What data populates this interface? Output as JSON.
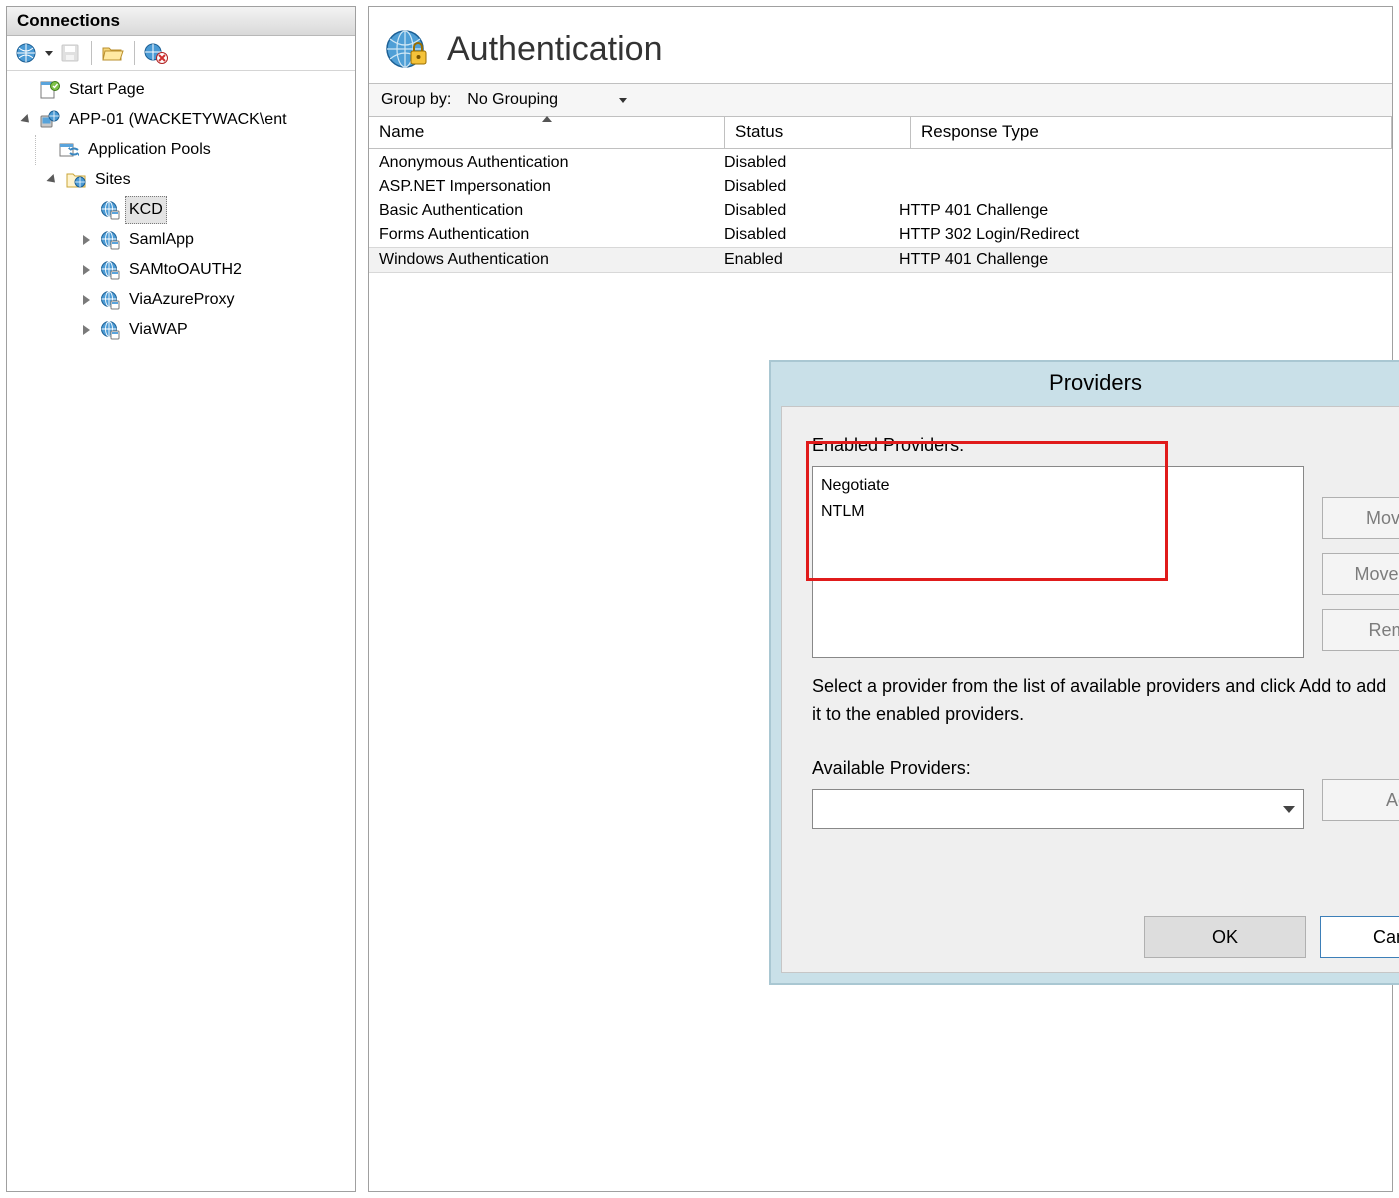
{
  "connections": {
    "title": "Connections",
    "toolbar": {
      "connect_icon": "globe-connect",
      "save_icon": "save",
      "open_icon": "open-folder",
      "remove_icon": "remove-connection"
    },
    "tree": {
      "start_page": "Start Page",
      "server": "APP-01 (WACKETYWACK\\ent",
      "app_pools": "Application Pools",
      "sites": "Sites",
      "items": [
        {
          "label": "KCD",
          "selected": true,
          "expandable": false
        },
        {
          "label": "SamlApp",
          "selected": false,
          "expandable": true
        },
        {
          "label": "SAMtoOAUTH2",
          "selected": false,
          "expandable": true
        },
        {
          "label": "ViaAzureProxy",
          "selected": false,
          "expandable": true
        },
        {
          "label": "ViaWAP",
          "selected": false,
          "expandable": true
        }
      ]
    }
  },
  "main": {
    "title": "Authentication",
    "group_by_label": "Group by:",
    "group_by_value": "No Grouping",
    "columns": {
      "name": "Name",
      "status": "Status",
      "response": "Response Type"
    },
    "rows": [
      {
        "name": "Anonymous Authentication",
        "status": "Disabled",
        "response": ""
      },
      {
        "name": "ASP.NET Impersonation",
        "status": "Disabled",
        "response": ""
      },
      {
        "name": "Basic Authentication",
        "status": "Disabled",
        "response": "HTTP 401 Challenge"
      },
      {
        "name": "Forms Authentication",
        "status": "Disabled",
        "response": "HTTP 302 Login/Redirect"
      },
      {
        "name": "Windows Authentication",
        "status": "Enabled",
        "response": "HTTP 401 Challenge",
        "selected": true
      }
    ]
  },
  "dialog": {
    "title": "Providers",
    "help": "?",
    "close": "x",
    "enabled_label": "Enabled Providers:",
    "enabled_items": [
      "Negotiate",
      "NTLM"
    ],
    "instructions": "Select a provider from the list of available providers and click Add to add it to the enabled providers.",
    "available_label": "Available Providers:",
    "buttons": {
      "move_up": "Move Up",
      "move_down": "Move Down",
      "remove": "Remove",
      "add": "Add",
      "ok": "OK",
      "cancel": "Cancel"
    }
  }
}
